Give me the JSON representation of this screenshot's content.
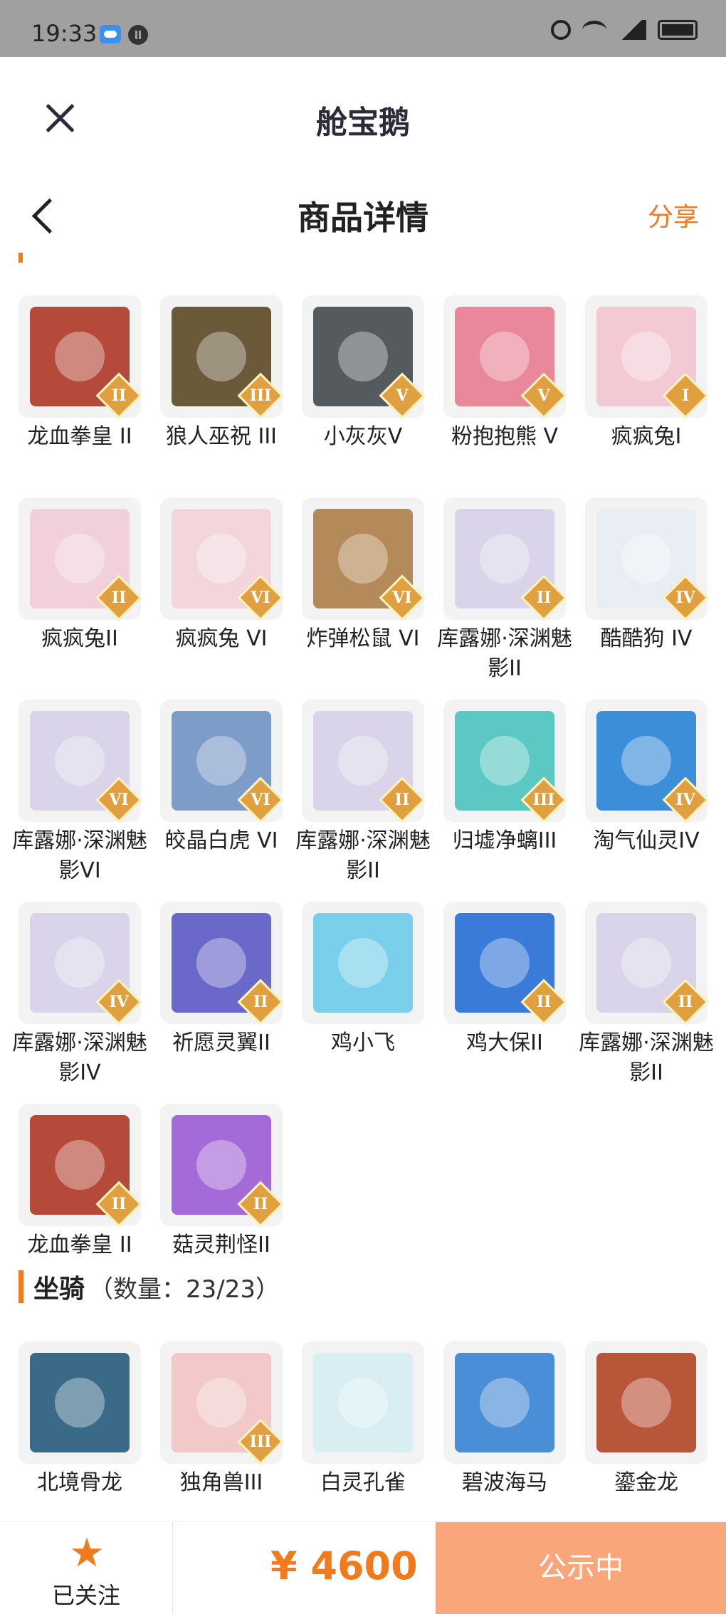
{
  "status_bar": {
    "time": "19:33",
    "network": "4G"
  },
  "header": {
    "app_title": "舱宝鹅"
  },
  "nav": {
    "title": "商品详情",
    "share_label": "分享"
  },
  "items": [
    {
      "name": "龙血拳皇 II",
      "badge": "II",
      "color": "#b54a3a"
    },
    {
      "name": "狼人巫祝 III",
      "badge": "III",
      "color": "#6b5a3a"
    },
    {
      "name": "小灰灰V",
      "badge": "V",
      "color": "#555a5e"
    },
    {
      "name": "粉抱抱熊 V",
      "badge": "V",
      "color": "#e8889a"
    },
    {
      "name": "疯疯兔I",
      "badge": "I",
      "color": "#f3c9d4"
    },
    {
      "name": "疯疯兔II",
      "badge": "II",
      "color": "#f1d0dc"
    },
    {
      "name": "疯疯兔 VI",
      "badge": "VI",
      "color": "#f2d6dc"
    },
    {
      "name": "炸弹松鼠 VI",
      "badge": "VI",
      "color": "#b48a5a"
    },
    {
      "name": "库露娜·深渊魅影II",
      "badge": "II",
      "color": "#d9d4ea"
    },
    {
      "name": "酷酷狗 IV",
      "badge": "IV",
      "color": "#e9eef4"
    },
    {
      "name": "库露娜·深渊魅影VI",
      "badge": "VI",
      "color": "#d9d4ea"
    },
    {
      "name": "皎晶白虎 VI",
      "badge": "VI",
      "color": "#7d9cc8"
    },
    {
      "name": "库露娜·深渊魅影II",
      "badge": "II",
      "color": "#d9d4ea"
    },
    {
      "name": "归墟净螭III",
      "badge": "III",
      "color": "#5cc8c4"
    },
    {
      "name": "淘气仙灵IV",
      "badge": "IV",
      "color": "#3c8ed8"
    },
    {
      "name": "库露娜·深渊魅影IV",
      "badge": "IV",
      "color": "#d9d4ea"
    },
    {
      "name": "祈愿灵翼II",
      "badge": "II",
      "color": "#6a68c8"
    },
    {
      "name": "鸡小飞",
      "badge": "",
      "color": "#7ad0ea"
    },
    {
      "name": "鸡大保II",
      "badge": "II",
      "color": "#3a7ad8"
    },
    {
      "name": "库露娜·深渊魅影II",
      "badge": "II",
      "color": "#d9d4ea"
    },
    {
      "name": "龙血拳皇 II",
      "badge": "II",
      "color": "#b54a3a"
    },
    {
      "name": "菇灵荆怪II",
      "badge": "II",
      "color": "#a46ad8"
    }
  ],
  "mounts_section": {
    "title": "坐骑",
    "count_text": "（数量：23/23）"
  },
  "mounts": [
    {
      "name": "北境骨龙",
      "badge": "",
      "color": "#3a6a88"
    },
    {
      "name": "独角兽III",
      "badge": "III",
      "color": "#f2c8c8"
    },
    {
      "name": "白灵孔雀",
      "badge": "",
      "color": "#d8eef2"
    },
    {
      "name": "碧波海马",
      "badge": "",
      "color": "#4a8ed8"
    },
    {
      "name": "鎏金龙",
      "badge": "",
      "color": "#b8563a"
    }
  ],
  "bottom_bar": {
    "follow_label": "已关注",
    "price": "¥ 4600",
    "status_button": "公示中"
  }
}
